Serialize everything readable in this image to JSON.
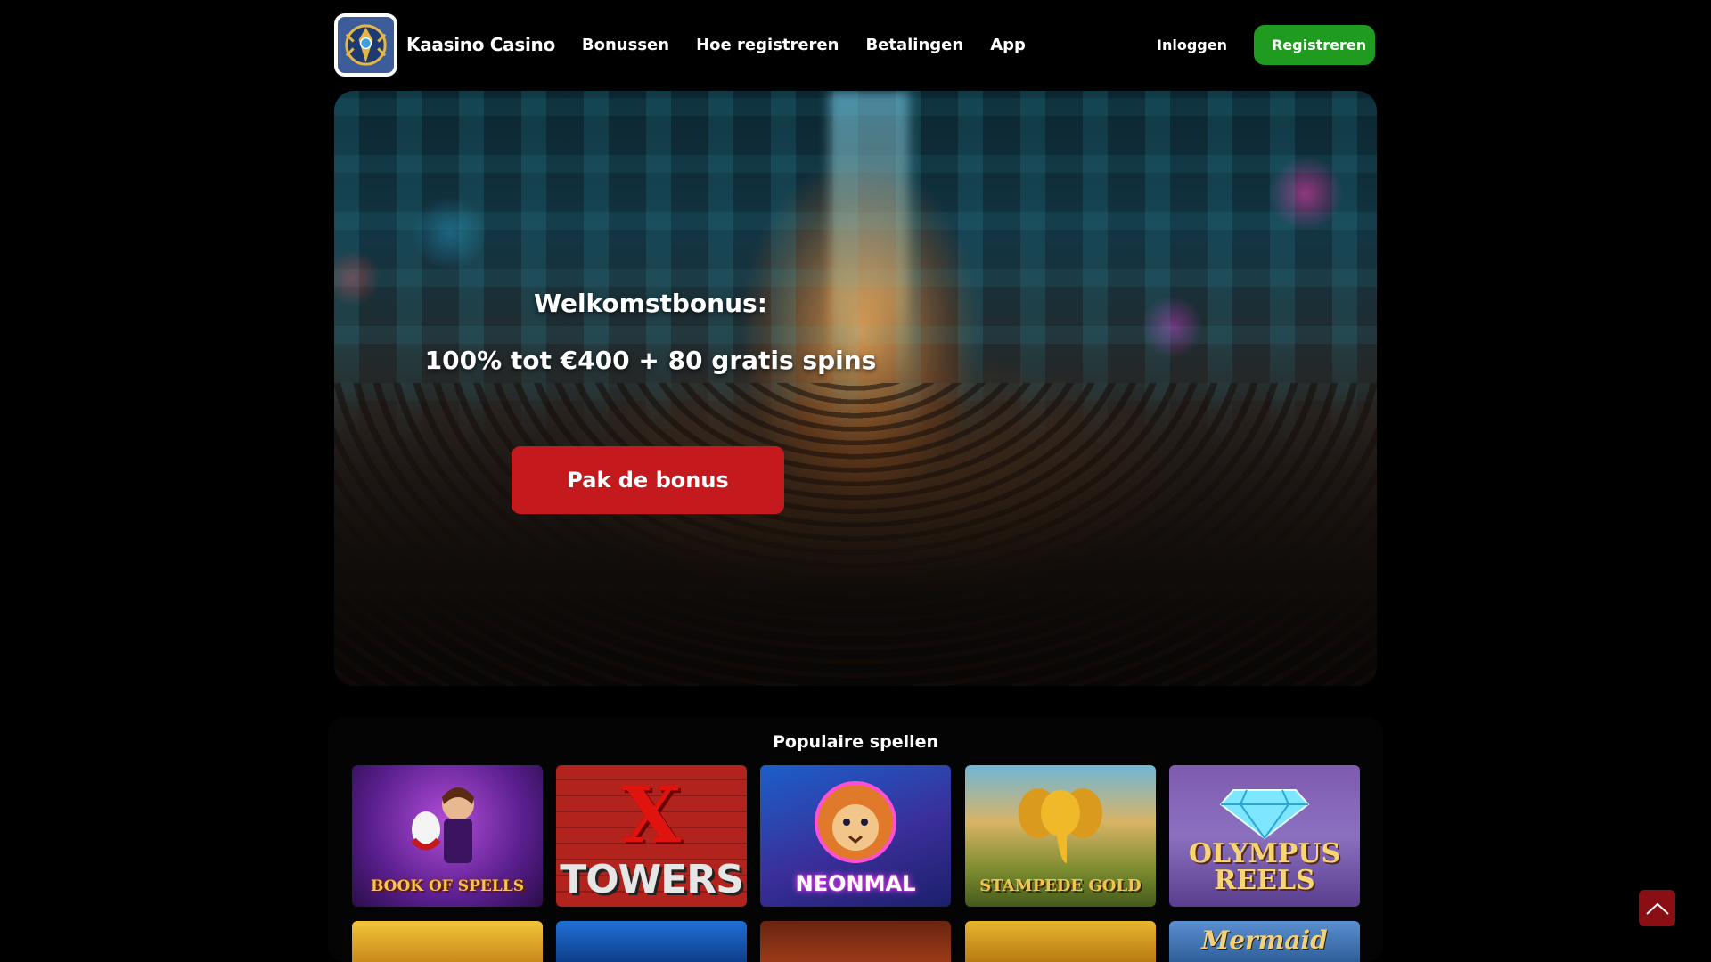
{
  "header": {
    "brand": "Kaasino Casino",
    "nav": [
      "Bonussen",
      "Hoe registreren",
      "Betalingen",
      "App"
    ],
    "login_label": "Inloggen",
    "register_label": "Registreren"
  },
  "hero": {
    "title": "Welkomstbonus:",
    "offer": "100% tot €400 + 80 gratis spins",
    "cta_label": "Pak de bonus"
  },
  "games": {
    "title": "Populaire spellen",
    "row1": [
      {
        "label": "BOOK OF SPELLS"
      },
      {
        "label": "TOWERS",
        "mark": "X"
      },
      {
        "label": "NEONMAL"
      },
      {
        "label": "STAMPEDE GOLD"
      },
      {
        "label": "OLYMPUS REELS"
      }
    ],
    "row2": [
      {
        "label": ""
      },
      {
        "label": ""
      },
      {
        "label": ""
      },
      {
        "label": ""
      },
      {
        "label": "Mermaid"
      }
    ]
  },
  "colors": {
    "accent_green": "#1f9b1f",
    "cta_red": "#c41a1e",
    "to_top_red": "#8a0f14",
    "background": "#000000"
  },
  "icons": {
    "logo": "heraldic-crest-icon",
    "back_to_top": "chevron-up-icon"
  }
}
